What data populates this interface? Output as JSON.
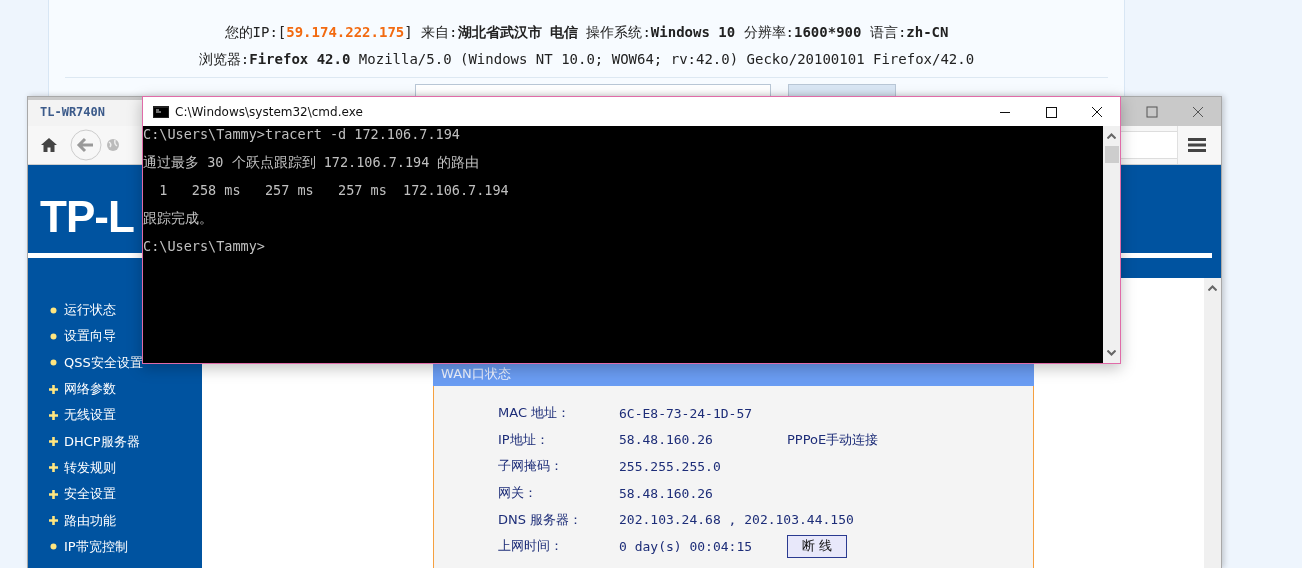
{
  "info_page": {
    "lines": [
      [
        {
          "text": "您的IP:[",
          "kind": "plain"
        },
        {
          "text": "59.174.222.175",
          "kind": "highlight"
        },
        {
          "text": "] 来自:",
          "kind": "plain"
        },
        {
          "text": "湖北省武汉市 电信",
          "kind": "bold"
        },
        {
          "text": " 操作系统:",
          "kind": "plain"
        },
        {
          "text": "Windows 10",
          "kind": "bold"
        },
        {
          "text": " 分辨率:",
          "kind": "plain"
        },
        {
          "text": "1600*900",
          "kind": "bold"
        },
        {
          "text": " 语言:",
          "kind": "plain"
        },
        {
          "text": "zh-CN",
          "kind": "bold"
        }
      ],
      [
        {
          "text": "浏览器:",
          "kind": "plain"
        },
        {
          "text": "Firefox 42.0",
          "kind": "bold"
        },
        {
          "text": " Mozilla/5.0 (Windows NT 10.0; WOW64; rv:42.0) Gecko/20100101 Firefox/42.0",
          "kind": "plain"
        }
      ]
    ]
  },
  "browser": {
    "tab_title": "TL-WR740N",
    "logo": "TP-L",
    "menu": [
      {
        "label": "运行状态",
        "expandable": false
      },
      {
        "label": "设置向导",
        "expandable": false
      },
      {
        "label": "QSS安全设置",
        "expandable": false
      },
      {
        "label": "网络参数",
        "expandable": true
      },
      {
        "label": "无线设置",
        "expandable": true
      },
      {
        "label": "DHCP服务器",
        "expandable": true
      },
      {
        "label": "转发规则",
        "expandable": true
      },
      {
        "label": "安全设置",
        "expandable": true
      },
      {
        "label": "路由功能",
        "expandable": true
      },
      {
        "label": "IP带宽控制",
        "expandable": false
      }
    ],
    "wan": {
      "title": "WAN口状态",
      "rows": [
        {
          "label": "MAC 地址：",
          "value": "6C-E8-73-24-1D-57"
        },
        {
          "label": "IP地址：",
          "value": "58.48.160.26",
          "extra": "PPPoE手动连接"
        },
        {
          "label": "子网掩码：",
          "value": "255.255.255.0"
        },
        {
          "label": "网关：",
          "value": "58.48.160.26"
        },
        {
          "label": "DNS 服务器：",
          "value": "202.103.24.68 , 202.103.44.150"
        },
        {
          "label": "上网时间：",
          "value": "0 day(s) 00:04:15",
          "button": "断 线"
        }
      ]
    }
  },
  "terminal": {
    "title": "C:\\Windows\\system32\\cmd.exe",
    "lines": [
      "C:\\Users\\Tammy>tracert -d 172.106.7.194",
      "通过最多 30 个跃点跟踪到 172.106.7.194 的路由",
      "  1   258 ms   257 ms   257 ms  172.106.7.194",
      "跟踪完成。",
      "C:\\Users\\Tammy>"
    ]
  }
}
